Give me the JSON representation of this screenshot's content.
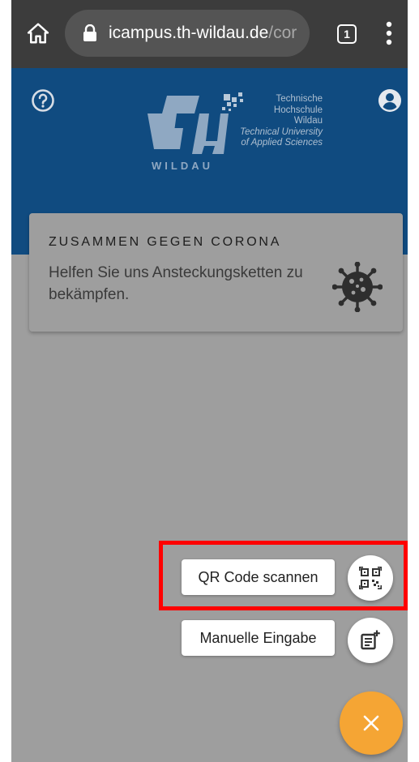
{
  "browser": {
    "url_main": "icampus.th-wildau.de",
    "url_rest": "/cor",
    "tab_count": "1",
    "icons": {
      "home": "home-icon",
      "lock": "lock-icon",
      "menu": "more-vert-icon"
    }
  },
  "header": {
    "logo_wordmark": "WILDAU",
    "logo_lines": [
      "Technische",
      "Hochschule",
      "Wildau",
      "Technical University",
      "of Applied Sciences"
    ],
    "icons": {
      "help": "help-circle-icon",
      "account": "account-circle-icon"
    },
    "color": "#104b80"
  },
  "card": {
    "title": "ZUSAMMEN GEGEN CORONA",
    "text": "Helfen Sie uns Ansteckungsketten zu bekämpfen.",
    "icon": "virus-icon"
  },
  "speed_dial": {
    "qr_label": "QR Code scannen",
    "manual_label": "Manuelle Eingabe",
    "qr_icon": "qr-code-scan-icon",
    "manual_icon": "note-add-icon",
    "close_icon": "close-icon",
    "fab_color": "#f5a534"
  },
  "overlay": {
    "highlight_color": "#ff0000"
  }
}
